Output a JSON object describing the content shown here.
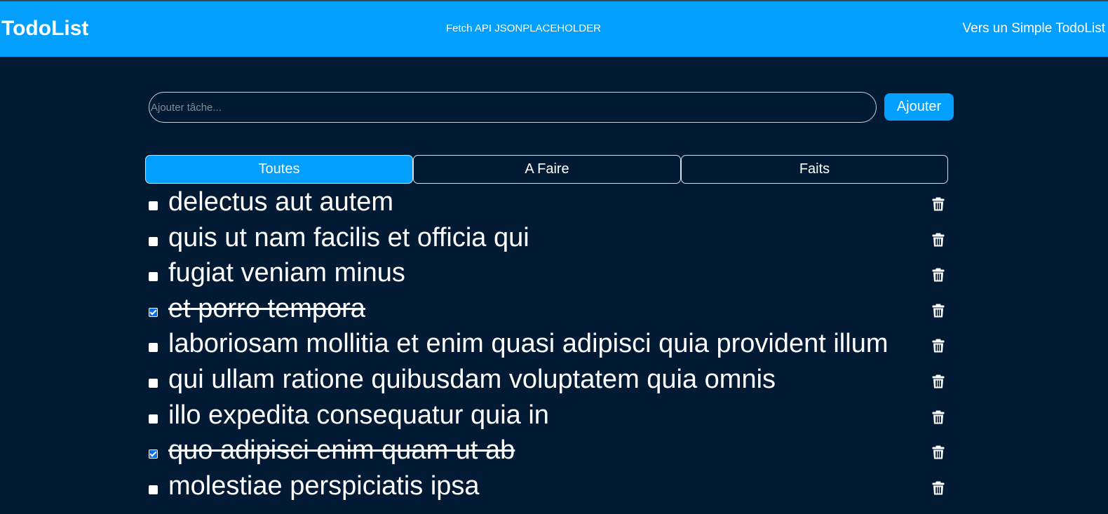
{
  "navbar": {
    "brand": "TodoList",
    "subtitle": "Fetch API JSONPLACEHOLDER",
    "link": "Vers un Simple TodoList"
  },
  "form": {
    "placeholder": "Ajouter tâche...",
    "value": "",
    "add_label": "Ajouter"
  },
  "tabs": [
    {
      "label": "Toutes",
      "active": true
    },
    {
      "label": "A Faire",
      "active": false
    },
    {
      "label": "Faits",
      "active": false
    }
  ],
  "todos": [
    {
      "title": "delectus aut autem",
      "completed": false
    },
    {
      "title": "quis ut nam facilis et officia qui",
      "completed": false
    },
    {
      "title": "fugiat veniam minus",
      "completed": false
    },
    {
      "title": "et porro tempora",
      "completed": true
    },
    {
      "title": "laboriosam mollitia et enim quasi adipisci quia provident illum",
      "completed": false
    },
    {
      "title": "qui ullam ratione quibusdam voluptatem quia omnis",
      "completed": false
    },
    {
      "title": "illo expedita consequatur quia in",
      "completed": false
    },
    {
      "title": "quo adipisci enim quam ut ab",
      "completed": true
    },
    {
      "title": "molestiae perspiciatis ipsa",
      "completed": false
    }
  ],
  "icons": {
    "delete": "trash-icon"
  },
  "colors": {
    "accent": "#039ffe",
    "background": "#031a35",
    "text": "#ffffff"
  }
}
